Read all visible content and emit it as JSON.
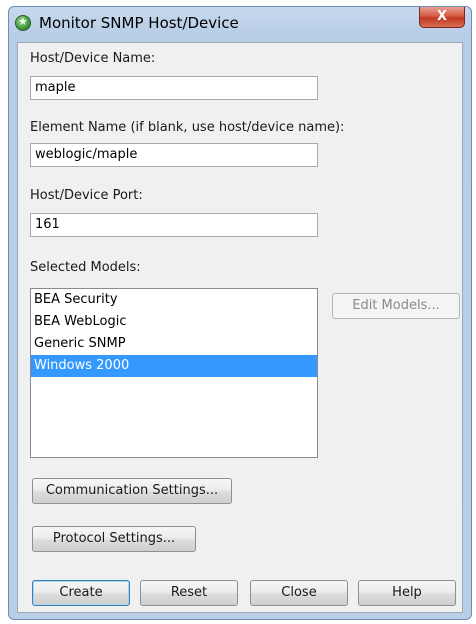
{
  "window": {
    "title": "Monitor SNMP Host/Device",
    "close_glyph": "X",
    "icon": "green-star-icon"
  },
  "form": {
    "host_label": "Host/Device Name:",
    "host_value": "maple",
    "element_label": "Element Name (if blank, use host/device name):",
    "element_value": "weblogic/maple",
    "port_label": "Host/Device Port:",
    "port_value": "161",
    "models_label": "Selected Models:",
    "models": [
      {
        "label": "BEA Security",
        "selected": false
      },
      {
        "label": "BEA WebLogic",
        "selected": false
      },
      {
        "label": "Generic SNMP",
        "selected": false
      },
      {
        "label": "Windows 2000",
        "selected": true
      }
    ],
    "edit_models_label": "Edit Models...",
    "communication_label": "Communication Settings...",
    "protocol_label": "Protocol Settings..."
  },
  "buttons": {
    "create": "Create",
    "reset": "Reset",
    "close": "Close",
    "help": "Help"
  },
  "colors": {
    "selection": "#3399ff",
    "title_bar": "#b9cfe7",
    "close_button": "#c23a22"
  }
}
